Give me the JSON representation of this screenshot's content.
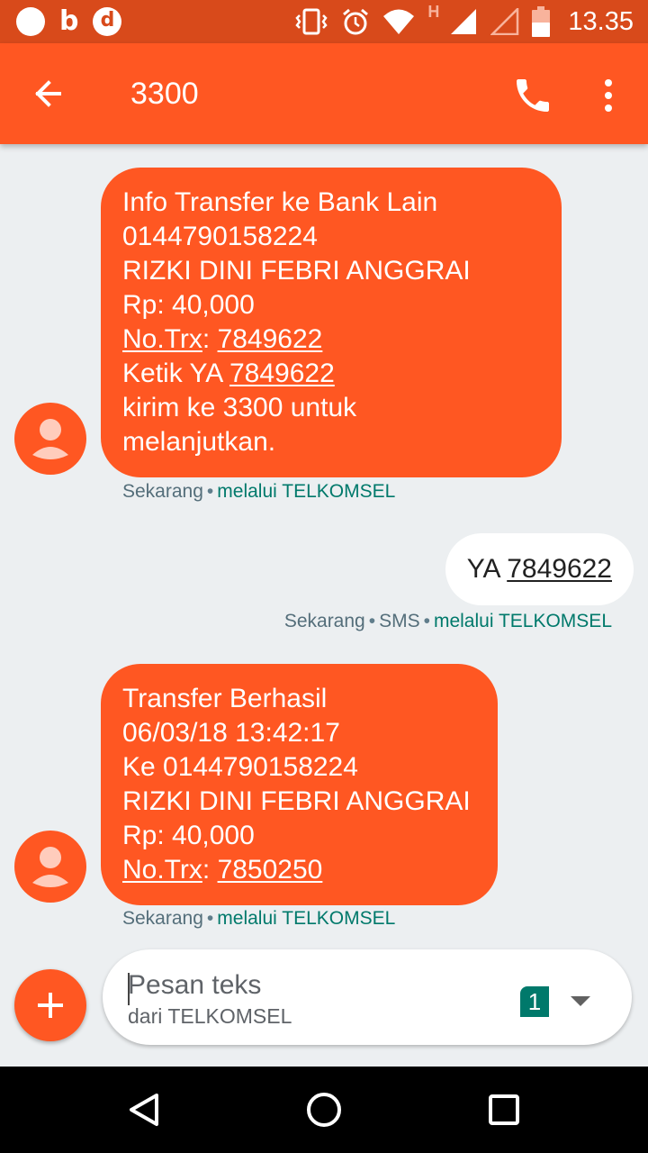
{
  "status_bar": {
    "time": "13.35",
    "left_icons": [
      "notification-dot-icon",
      "b-app-icon",
      "d-app-icon"
    ],
    "b_glyph": "b",
    "d_glyph": "d",
    "network_type": "H",
    "right_icons": [
      "vibrate-icon",
      "alarm-icon",
      "wifi-icon",
      "signal-icon",
      "signal-empty-icon",
      "battery-icon"
    ]
  },
  "toolbar": {
    "title": "3300",
    "back_icon": "arrow-back-icon",
    "call_icon": "phone-icon",
    "menu_icon": "more-vert-icon"
  },
  "messages": [
    {
      "direction": "incoming",
      "lines": {
        "l1": "Info Transfer ke Bank Lain",
        "l2": "0144790158224",
        "l3": "RIZKI DINI FEBRI ANGGRAI",
        "l4": "Rp: 40,000",
        "l5_label": "No.Trx",
        "l5_colon": ": ",
        "l5_value": "7849622",
        "l6_prefix": "Ketik YA ",
        "l6_value": "7849622",
        "l7": "kirim ke 3300 untuk",
        "l8": "melanjutkan."
      },
      "meta": {
        "time": "Sekarang",
        "separator": "•",
        "carrier": "melalui TELKOMSEL"
      }
    },
    {
      "direction": "outgoing",
      "prefix": "YA ",
      "value": "7849622",
      "meta": {
        "time": "Sekarang",
        "separator": "•",
        "type": "SMS",
        "carrier": "melalui TELKOMSEL"
      }
    },
    {
      "direction": "incoming",
      "lines": {
        "l1": "Transfer Berhasil",
        "l2": "06/03/18 13:42:17",
        "l3": "Ke 0144790158224",
        "l4": "RIZKI DINI FEBRI ANGGRAI",
        "l5": "Rp: 40,000",
        "l6_label": "No.Trx",
        "l6_colon": ": ",
        "l6_value": "7850250"
      },
      "meta": {
        "time": "Sekarang",
        "separator": "•",
        "carrier": "melalui TELKOMSEL"
      }
    }
  ],
  "compose": {
    "placeholder": "Pesan teks",
    "subtitle": "dari TELKOMSEL",
    "sim_number": "1",
    "add_icon": "add-icon",
    "sim_dropdown_icon": "dropdown-arrow-icon"
  },
  "nav_bar": {
    "back_icon": "nav-back-icon",
    "home_icon": "nav-home-icon",
    "recents_icon": "nav-recents-icon"
  },
  "colors": {
    "status_bar": "#d84a1b",
    "accent": "#ff5722",
    "background": "#eceff1",
    "carrier_text": "#00796b",
    "meta_text": "#546e7a"
  }
}
